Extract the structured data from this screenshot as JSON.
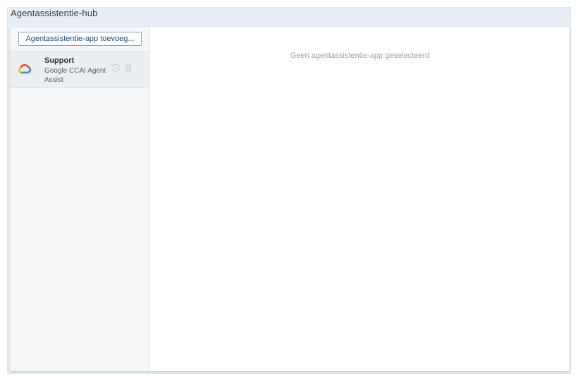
{
  "window": {
    "title": "Agentassistentie-hub"
  },
  "sidebar": {
    "add_button_label": "Agentassistentie-app toevoeg...",
    "items": [
      {
        "name": "Support",
        "type": "Google CCAI Agent Assist",
        "logo_icon": "google-cloud-icon",
        "actions": [
          "reset-icon",
          "trash-icon"
        ]
      }
    ]
  },
  "main": {
    "empty_message": "Geen agentassistentie-app geselecteerd"
  },
  "colors": {
    "frame_bg": "#e8eef5",
    "sidebar_bg": "#f4f6f8",
    "selected_item_bg": "#eceff2",
    "button_border": "#8aa6c3",
    "button_text": "#1f4f7f",
    "muted_text": "#9aa2aa"
  }
}
